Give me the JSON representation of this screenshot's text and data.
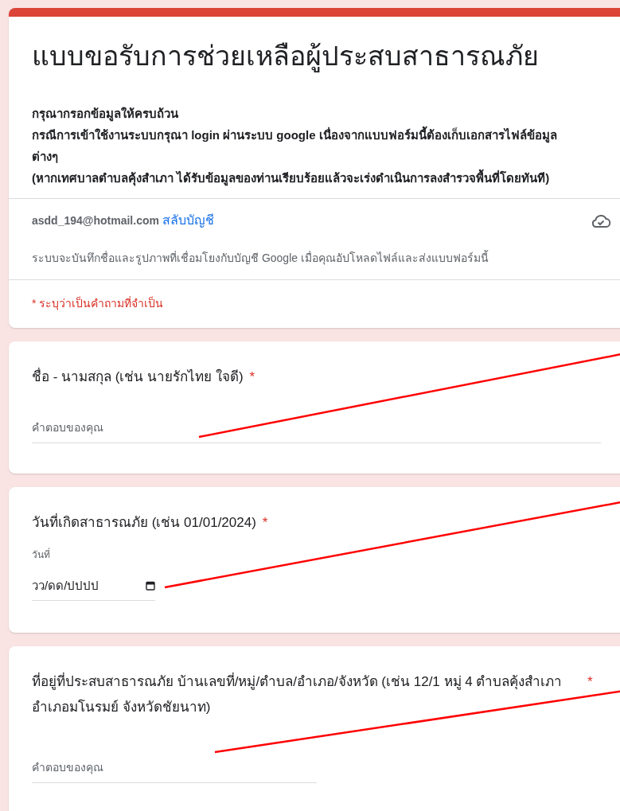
{
  "form": {
    "title": "แบบขอรับการช่วยเหลือผู้ประสบสาธารณภัย",
    "description": [
      "กรุณากรอกข้อมูลให้ครบถ้วน",
      "กรณีการเข้าใช้งานระบบกรุณา login ผ่านระบบ google เนื่องจากแบบฟอร์มนี้ต้องเก็บเอกสารไฟล์ข้อมูลต่างๆ",
      "(หากเทศบาลตำบลคุ้งสำเภา ได้รับข้อมูลของท่านเรียบร้อยแล้วจะเร่งดำเนินการลงสำรวจพื้นที่โดยทันที)"
    ],
    "account": {
      "email": "asdd_194@hotmail.com",
      "switch_link": "สลับบัญชี"
    },
    "notice": "ระบบจะบันทึกชื่อและรูปภาพที่เชื่อมโยงกับบัญชี Google เมื่อคุณอัปโหลดไฟล์และส่งแบบฟอร์มนี้",
    "required_note": "* ระบุว่าเป็นคำถามที่จำเป็น"
  },
  "questions": [
    {
      "kind": "text",
      "title": "ชื่อ - นามสกุล (เช่น นายรักไทย ใจดี)",
      "required_mark": "*",
      "placeholder": "คำตอบของคุณ",
      "annotated": true
    },
    {
      "kind": "date",
      "title": "วันที่เกิดสาธารณภัย (เช่น 01/01/2024)",
      "required_mark": "*",
      "field_label": "วันที่",
      "placeholder": "วว/ดด/ปปปป",
      "annotated": true
    },
    {
      "kind": "text",
      "title": "ที่อยู่ที่ประสบสาธารณภัย บ้านเลขที่/หมู่/ตำบล/อำเภอ/จังหวัด (เช่น 12/1 หมู่ 4 ตำบลคุ้งสำเภา อำเภอมโนรมย์ จังหวัดชัยนาท)",
      "required_mark": "*",
      "placeholder": "คำตอบของคุณ",
      "annotated": true
    }
  ]
}
